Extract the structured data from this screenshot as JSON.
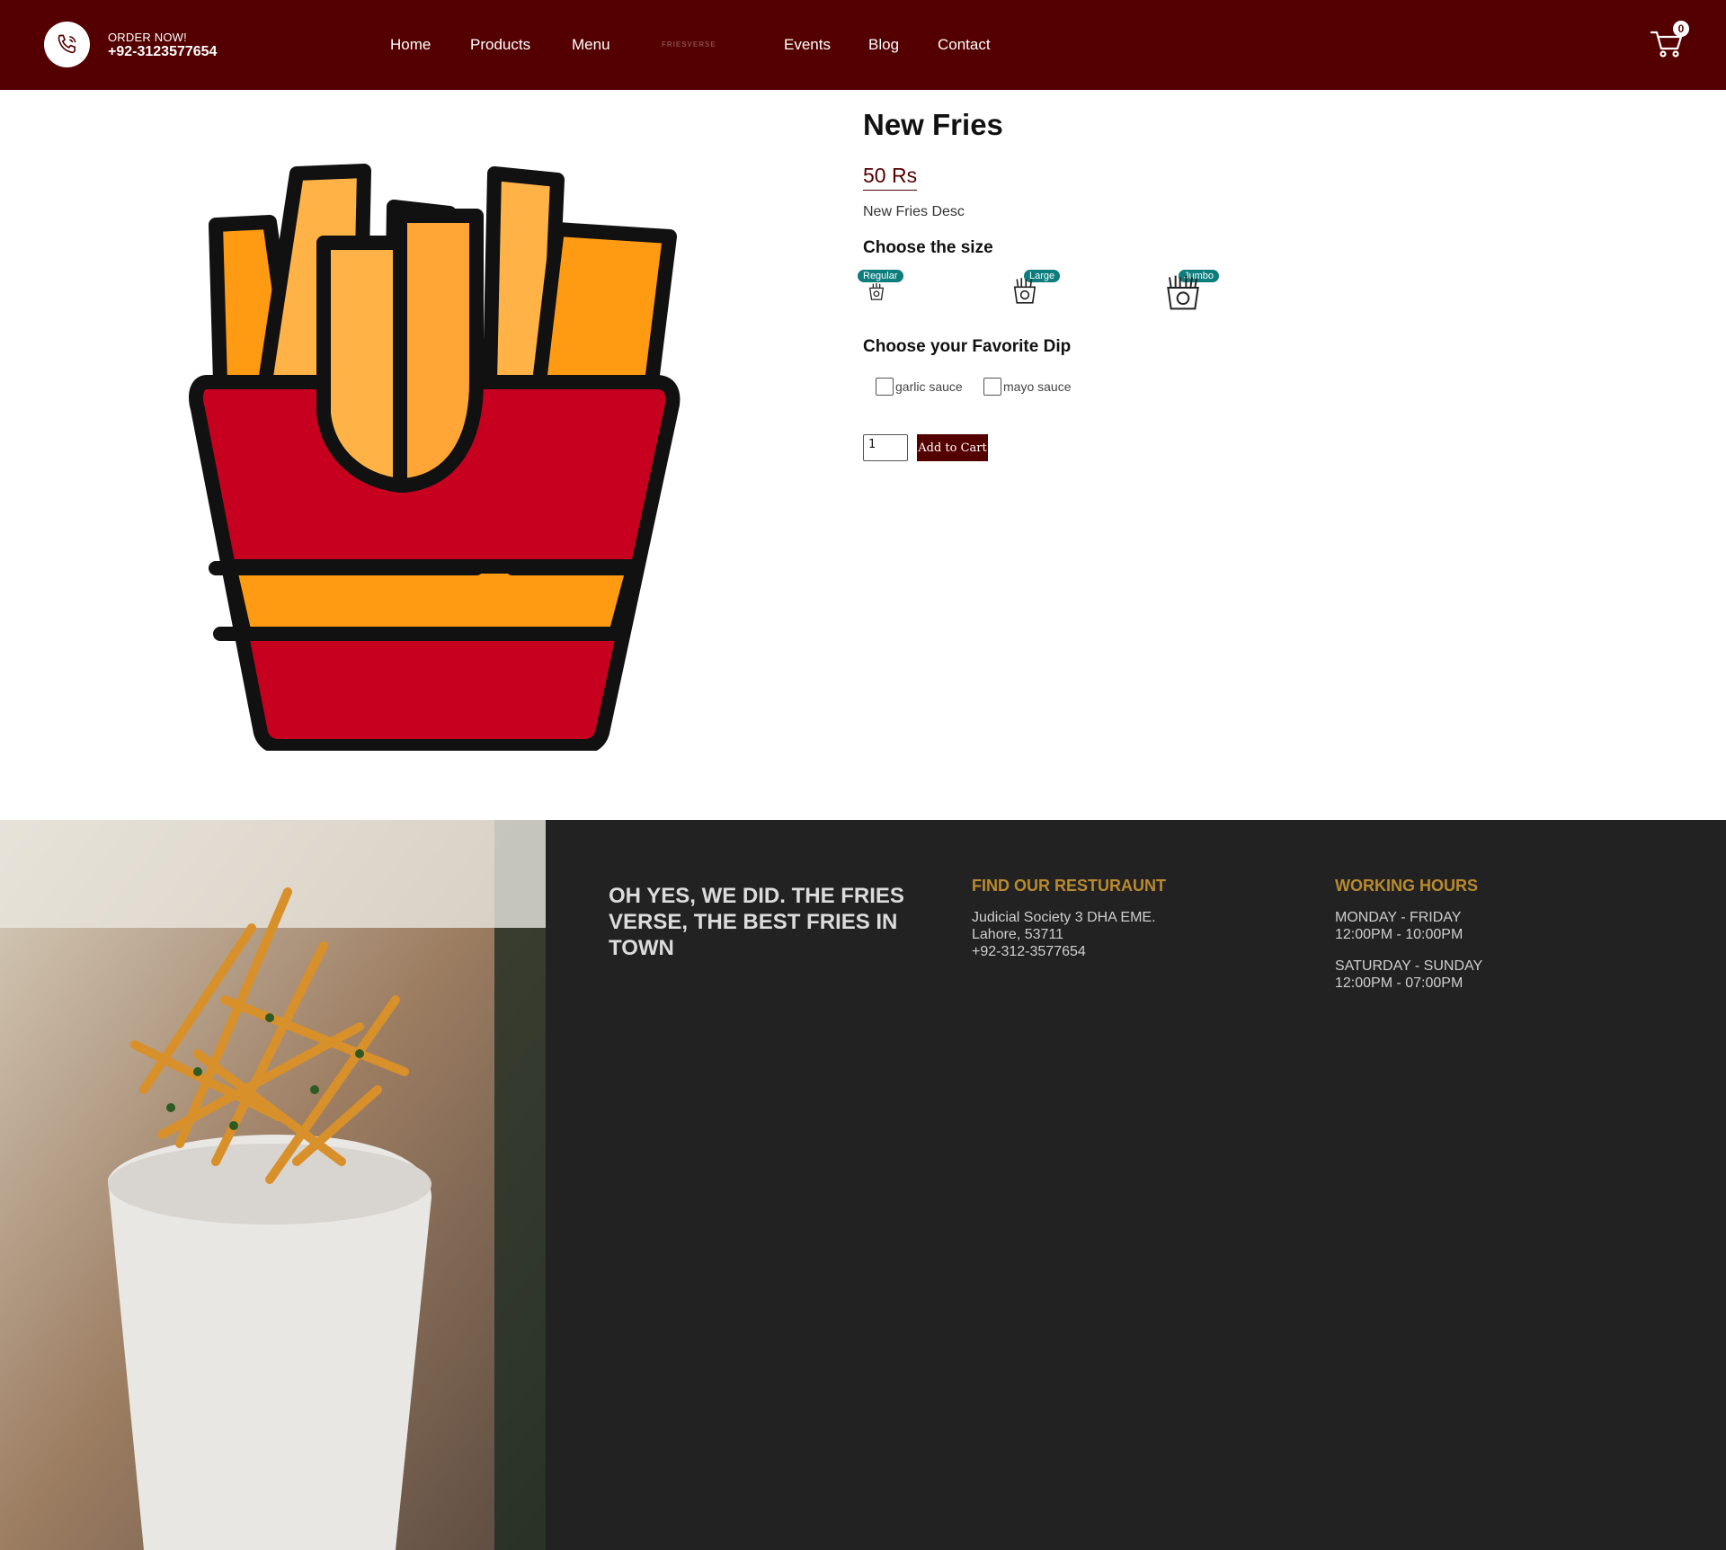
{
  "header": {
    "order_now": "ORDER NOW!",
    "phone": "+92-3123577654",
    "nav": [
      "Home",
      "Products",
      "Menu",
      "Events",
      "Blog",
      "Contact"
    ],
    "logo_text": "FRIESVERSE",
    "cart_count": "0"
  },
  "product": {
    "title": "New Fries",
    "price": "50 Rs",
    "description": "New Fries Desc",
    "size_label": "Choose the size",
    "sizes": [
      "Regular",
      "Large",
      "Jumbo"
    ],
    "dip_label": "Choose your Favorite Dip",
    "dips": [
      "garlic sauce",
      "mayo sauce"
    ],
    "quantity": "1",
    "add_to_cart": "Add to Cart"
  },
  "footer": {
    "tagline": "OH YES, WE DID. THE FRIES VERSE, THE BEST FRIES IN TOWN",
    "find_heading": "FIND OUR RESTURAUNT",
    "address_line1": "Judicial Society 3 DHA EME.",
    "address_line2": "Lahore, 53711",
    "address_phone": "+92-312-3577654",
    "hours_heading": "WORKING HOURS",
    "weekday_days": "MONDAY - FRIDAY",
    "weekday_hours": "12:00PM - 10:00PM",
    "weekend_days": "SATURDAY - SUNDAY",
    "weekend_hours": "12:00PM - 07:00PM"
  },
  "colors": {
    "brand": "#540000",
    "badge": "#0e7d7d",
    "footer_bg": "#222222",
    "footer_heading": "#b98a2e"
  },
  "icons": [
    "phone-icon",
    "cart-icon",
    "fries-illustration",
    "fries-size-icon",
    "fries-photo"
  ]
}
